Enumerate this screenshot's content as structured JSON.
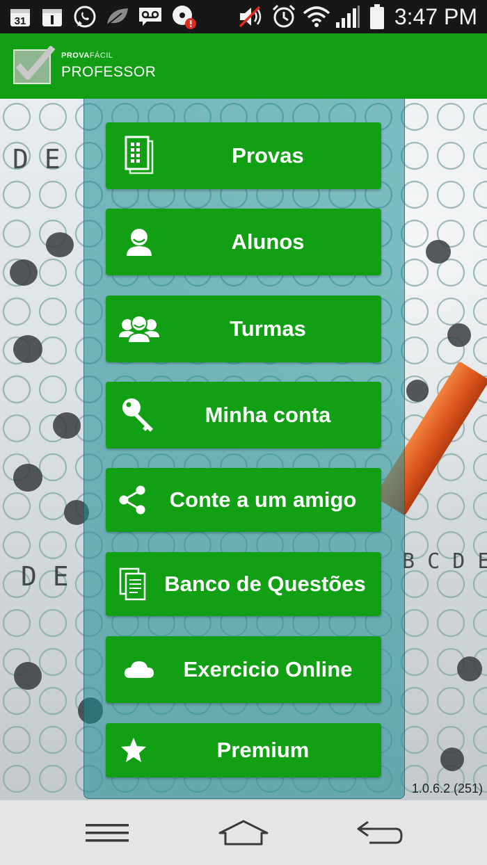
{
  "status_bar": {
    "time": "3:47 PM",
    "calendar_date": "31",
    "icons": [
      "calendar-icon",
      "calendar-day-icon",
      "whatsapp-icon",
      "leaf-icon",
      "voicemail-icon",
      "disc-alert-icon",
      "mute-icon",
      "alarm-icon",
      "wifi-icon",
      "signal-icon",
      "battery-icon"
    ]
  },
  "app_bar": {
    "brand_small_bold": "PROVA",
    "brand_small_thin": "FÁCIL",
    "brand_title": "PROFESSOR"
  },
  "menu": [
    {
      "label": "Provas",
      "icon": "document-grid-icon"
    },
    {
      "label": "Alunos",
      "icon": "user-icon"
    },
    {
      "label": "Turmas",
      "icon": "group-icon"
    },
    {
      "label": "Minha conta",
      "icon": "key-icon"
    },
    {
      "label": "Conte a um amigo",
      "icon": "share-icon"
    },
    {
      "label": "Banco de Questões",
      "icon": "copy-icon"
    },
    {
      "label": "Exercicio Online",
      "icon": "cloud-icon"
    },
    {
      "label": "Premium",
      "icon": "star-icon"
    }
  ],
  "version": "1.0.6.2 (251)",
  "colors": {
    "primary_green": "#119e14",
    "panel_teal": "#1a8c96",
    "status_bar": "#171717",
    "nav_bar": "#e4e6e6"
  },
  "nav_bar": {
    "icons": [
      "menu-icon",
      "home-icon",
      "back-icon"
    ]
  }
}
